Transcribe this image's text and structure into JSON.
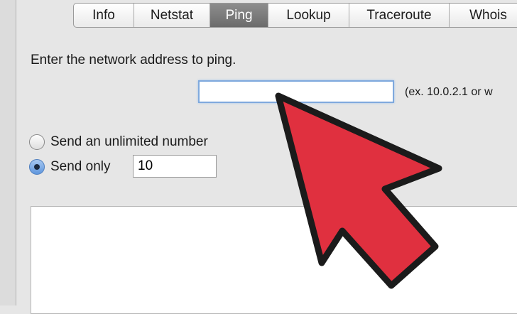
{
  "tabs": [
    {
      "label": "Info",
      "selected": false
    },
    {
      "label": "Netstat",
      "selected": false
    },
    {
      "label": "Ping",
      "selected": true
    },
    {
      "label": "Lookup",
      "selected": false
    },
    {
      "label": "Traceroute",
      "selected": false
    },
    {
      "label": "Whois",
      "selected": false
    }
  ],
  "ping": {
    "prompt": "Enter the network address to ping.",
    "address_value": "",
    "address_hint": "(ex. 10.0.2.1 or w",
    "unlimited_label": "Send an unlimited number",
    "unlimited_selected": false,
    "send_only_label": "Send only",
    "send_only_selected": true,
    "count_value": "10",
    "output_text": ""
  },
  "colors": {
    "cursor_fill": "#e0303f",
    "selected_tab": "#7a7a7a",
    "focus_ring": "#7fa9dd"
  },
  "icons": [
    "radio-button-icon",
    "pointer-arrow-icon"
  ]
}
